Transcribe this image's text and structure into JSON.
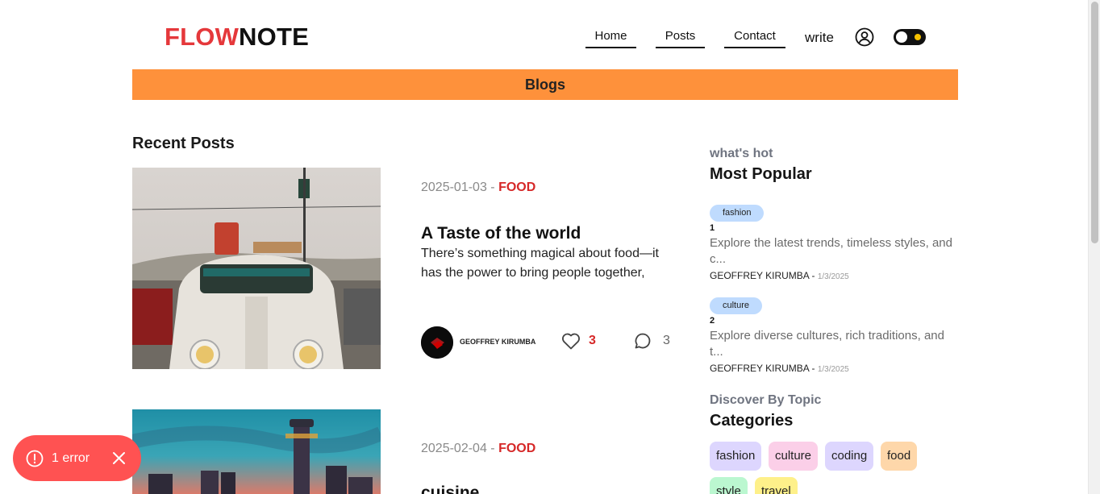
{
  "header": {
    "logo_part1": "FLOW",
    "logo_part2": "NOTE",
    "nav": [
      "Home",
      "Posts",
      "Contact"
    ],
    "write_label": "write"
  },
  "banner": {
    "label": "Blogs"
  },
  "recent": {
    "title": "Recent Posts",
    "posts": [
      {
        "date": "2025-01-03",
        "category": "FOOD",
        "title": "A Taste of the world",
        "desc": "There’s something magical about food—it has the power to bring people together,",
        "author": "GEOFFREY KIRUMBA",
        "likes": "3",
        "comments": "3"
      },
      {
        "date": "2025-02-04",
        "category": "FOOD",
        "title": "cuisine"
      }
    ]
  },
  "sidebar": {
    "popular_sub": "what's hot",
    "popular_title": "Most Popular",
    "popular": [
      {
        "tag": "fashion",
        "num": "1",
        "desc": "Explore the latest trends, timeless styles, and c...",
        "author": "GEOFFREY KIRUMBA",
        "date": "1/3/2025"
      },
      {
        "tag": "culture",
        "num": "2",
        "desc": "Explore diverse cultures, rich traditions, and t...",
        "author": "GEOFFREY KIRUMBA",
        "date": "1/3/2025"
      }
    ],
    "topics_sub": "Discover By Topic",
    "topics_title": "Categories",
    "categories": [
      {
        "label": "fashion",
        "color": "#ddd6fe"
      },
      {
        "label": "culture",
        "color": "#fbcfe8"
      },
      {
        "label": "coding",
        "color": "#ddd6fe"
      },
      {
        "label": "food",
        "color": "#fed7aa"
      },
      {
        "label": "style",
        "color": "#bbf7d0"
      },
      {
        "label": "travel",
        "color": "#fef08a"
      }
    ]
  },
  "error_toast": {
    "label": "1 error"
  },
  "colors": {
    "accent": "#e5383b",
    "banner": "#fe913b",
    "error": "#ff5252"
  }
}
